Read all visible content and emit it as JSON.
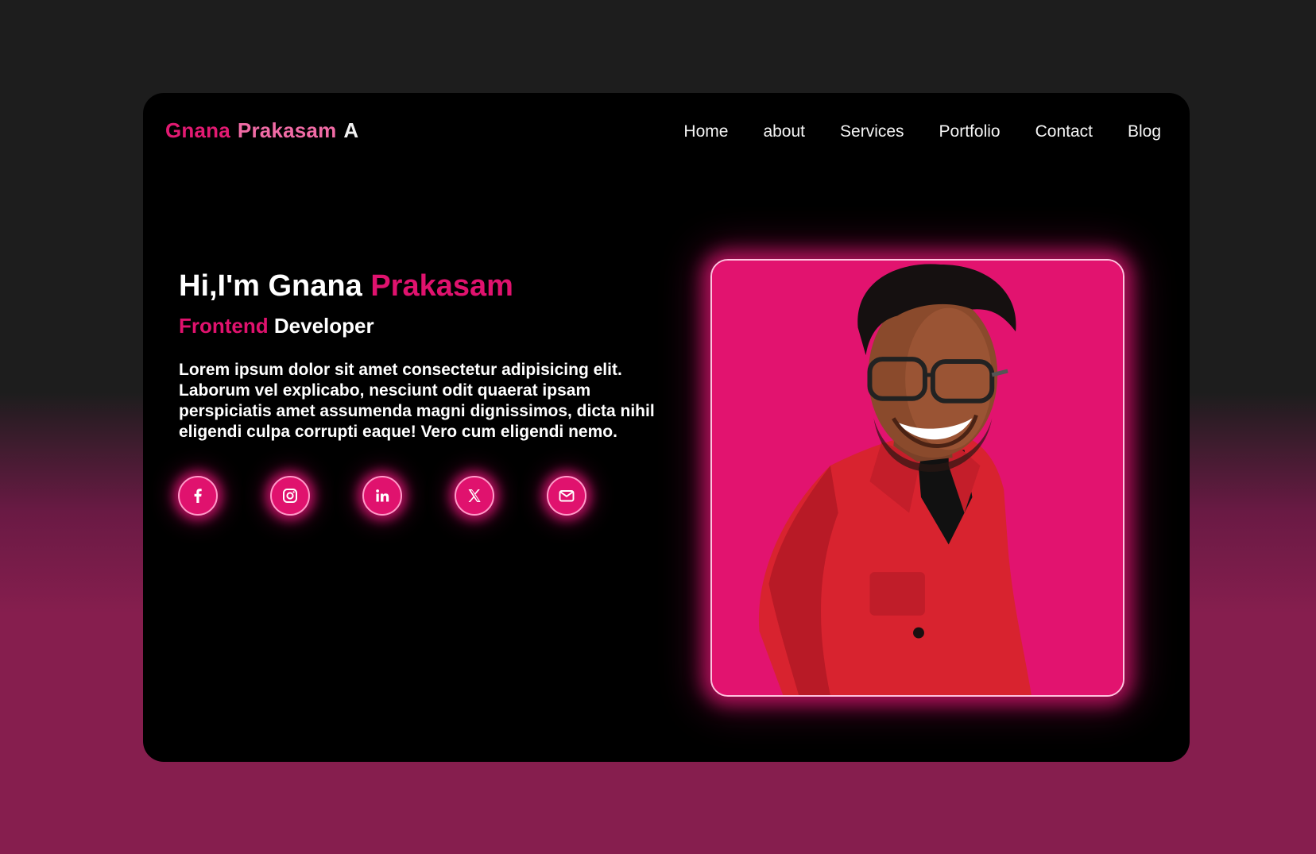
{
  "brand": {
    "first": "Gnana",
    "second": "Prakasam",
    "third": "A"
  },
  "nav": {
    "items": [
      {
        "label": "Home"
      },
      {
        "label": "about"
      },
      {
        "label": "Services"
      },
      {
        "label": "Portfolio"
      },
      {
        "label": "Contact"
      },
      {
        "label": "Blog"
      }
    ]
  },
  "hero": {
    "greeting": "Hi,I'm Gnana",
    "highlight_name": "Prakasam",
    "role_highlight": "Frontend",
    "role_rest": "Developer",
    "description": "Lorem ipsum dolor sit amet consectetur adipisicing elit. Laborum vel explicabo, nesciunt odit quaerat ipsam perspiciatis amet assumenda magni dignissimos, dicta nihil eligendi culpa corrupti eaque! Vero cum eligendi nemo."
  },
  "socials": [
    {
      "icon": "facebook-icon"
    },
    {
      "icon": "instagram-icon"
    },
    {
      "icon": "linkedin-icon"
    },
    {
      "icon": "x-twitter-icon"
    },
    {
      "icon": "mail-icon"
    }
  ],
  "colors": {
    "accent": "#e0126e",
    "background": "#000000",
    "page_gradient_bottom": "#861e4e"
  }
}
